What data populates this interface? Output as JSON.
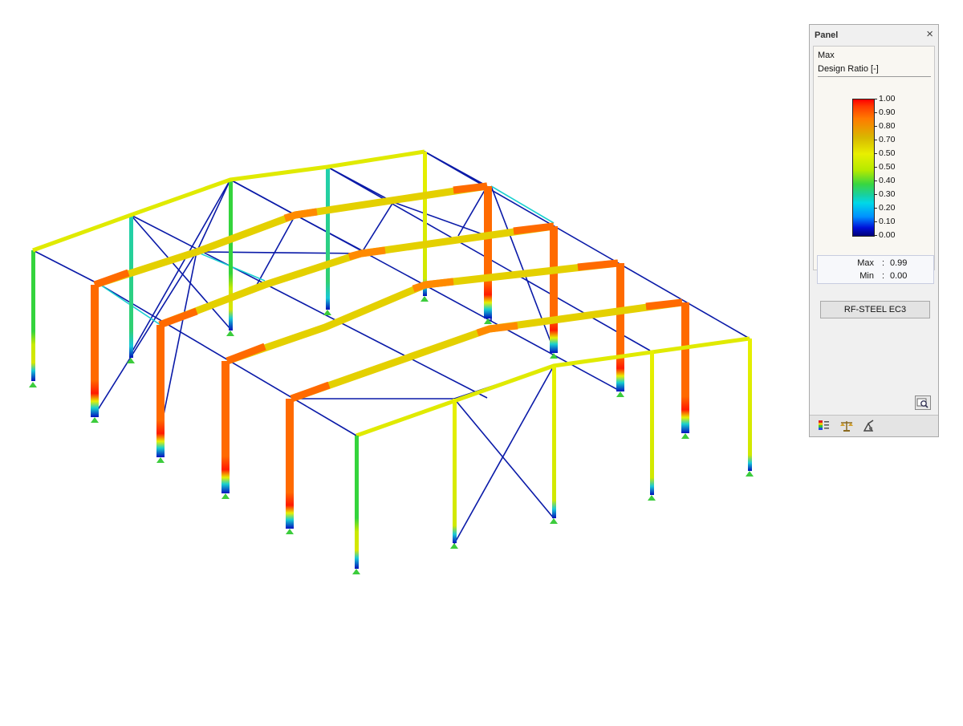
{
  "panel": {
    "title": "Panel",
    "result_label": "Max",
    "quantity_label": "Design Ratio [-]",
    "legend_ticks": [
      "1.00",
      "0.90",
      "0.80",
      "0.70",
      "0.50",
      "0.50",
      "0.40",
      "0.30",
      "0.20",
      "0.10",
      "0.00"
    ],
    "stats": {
      "max_label": "Max",
      "max_value": "0.99",
      "min_label": "Min",
      "min_value": "0.00",
      "separator": ":"
    },
    "module_button": "RF-STEEL EC3",
    "tabs": [
      "color-scale-tab",
      "balance-tab",
      "view-settings-tab"
    ]
  },
  "colors": {
    "ratio_100": "#ff0000",
    "ratio_90": "#ff6a00",
    "ratio_75": "#e0c800",
    "ratio_65": "#e8f000",
    "ratio_45": "#34d43c",
    "ratio_30": "#1ad0b8",
    "ratio_10": "#1a4fd8",
    "ratio_00": "#0a0aa0",
    "support": "#3ccc3c"
  }
}
